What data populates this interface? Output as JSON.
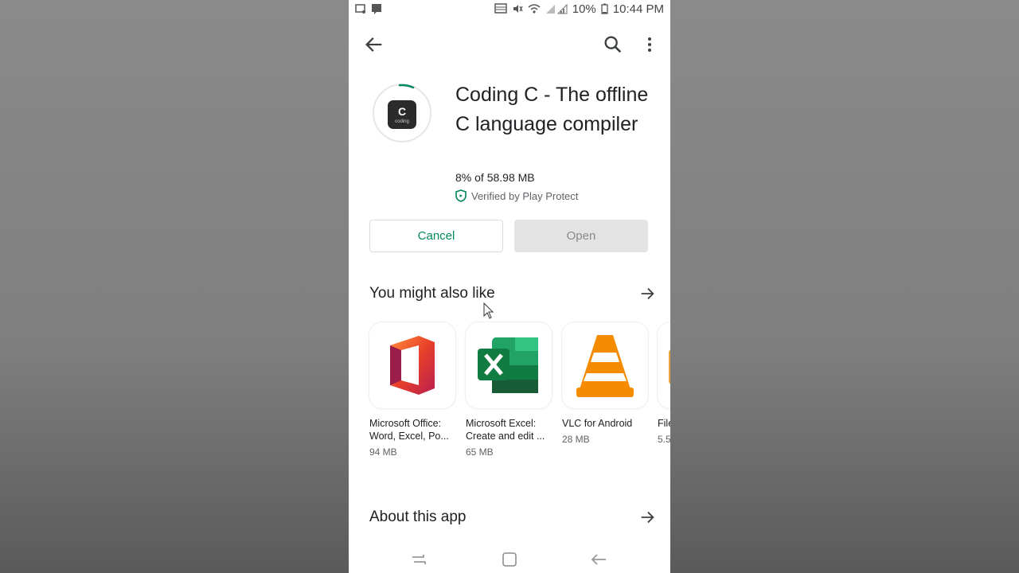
{
  "statusbar": {
    "battery": "10%",
    "time": "10:44 PM"
  },
  "toolbar": {
    "back_icon": "arrow-back-icon",
    "search_icon": "search-icon",
    "more_icon": "more-vert-icon"
  },
  "app": {
    "title": "Coding C - The offline C language compiler",
    "icon_letter": "C",
    "icon_sub": "coding",
    "progress_text": "8% of 58.98 MB",
    "download_progress": 0.08,
    "verified_text": "Verified by Play Protect",
    "accent_color": "#01875f"
  },
  "actions": {
    "cancel_label": "Cancel",
    "open_label": "Open"
  },
  "suggestions": {
    "title": "You might also like",
    "items": [
      {
        "name": "Microsoft Office: Word, Excel, Po...",
        "size": "94 MB"
      },
      {
        "name": "Microsoft Excel: Create and edit ...",
        "size": "65 MB"
      },
      {
        "name": "VLC for Android",
        "size": "28 MB"
      },
      {
        "name": "File",
        "size": "5.5"
      }
    ]
  },
  "about": {
    "title": "About this app"
  }
}
